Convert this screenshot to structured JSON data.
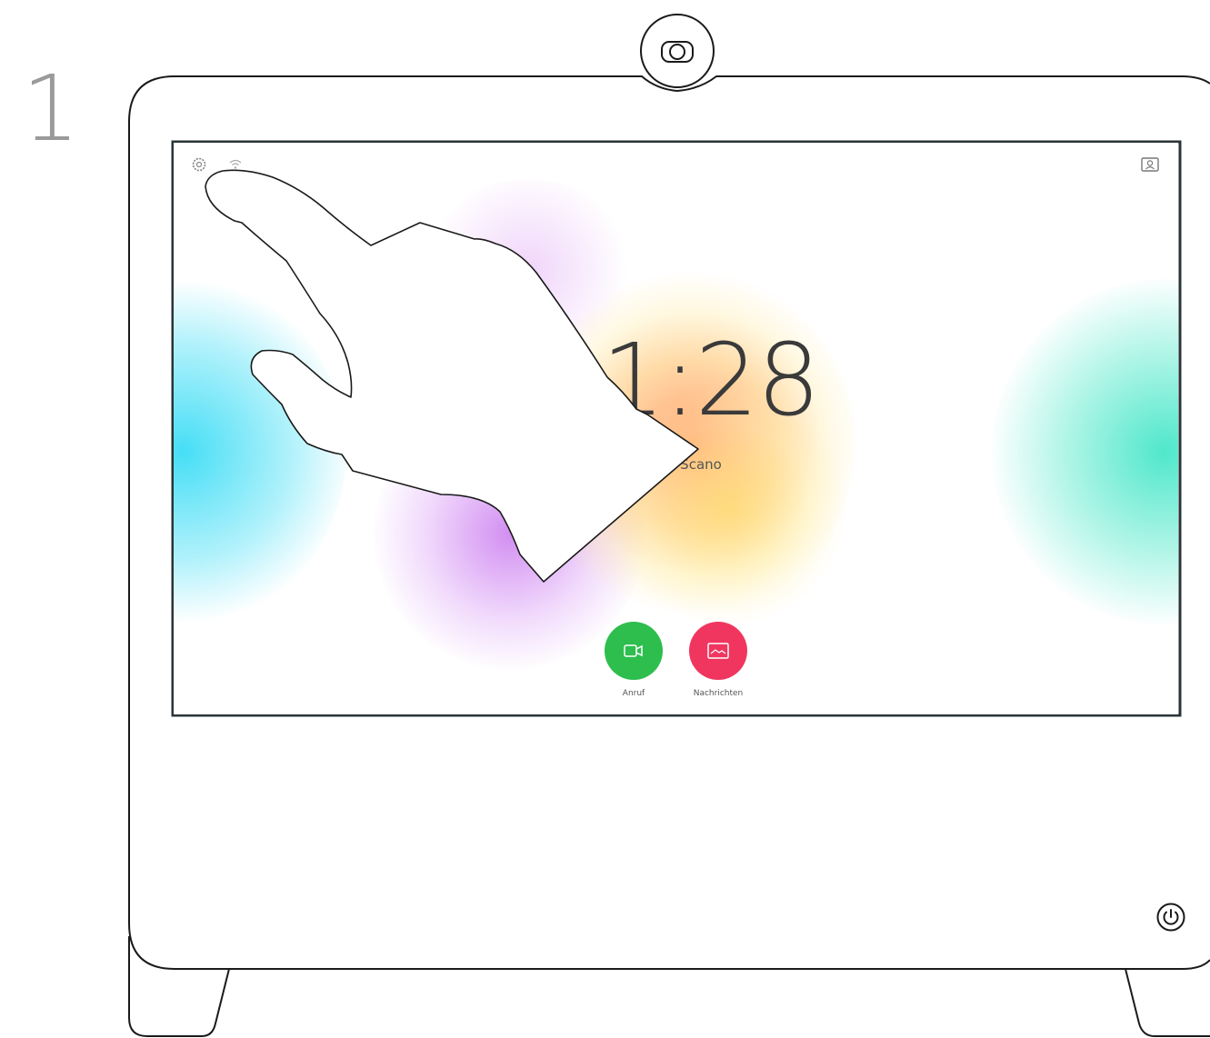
{
  "step": {
    "number": "1"
  },
  "screen": {
    "time": "1:28",
    "device_name": "Scano",
    "actions": [
      {
        "label": "Anruf",
        "icon": "video-camera-icon",
        "color": "#2dbe4e"
      },
      {
        "label": "Nachrichten",
        "icon": "message-icon",
        "color": "#f0365f"
      }
    ],
    "top_left_icons": [
      "gear-icon",
      "wifi-icon"
    ],
    "top_right_icon": "contacts-icon"
  },
  "device": {
    "camera_icon": "camera-icon",
    "power_icon": "power-icon"
  },
  "colors": {
    "call_green": "#2dbe4e",
    "message_red": "#f0365f",
    "outline": "#1a1a1a",
    "screen_border": "#2a3438"
  }
}
